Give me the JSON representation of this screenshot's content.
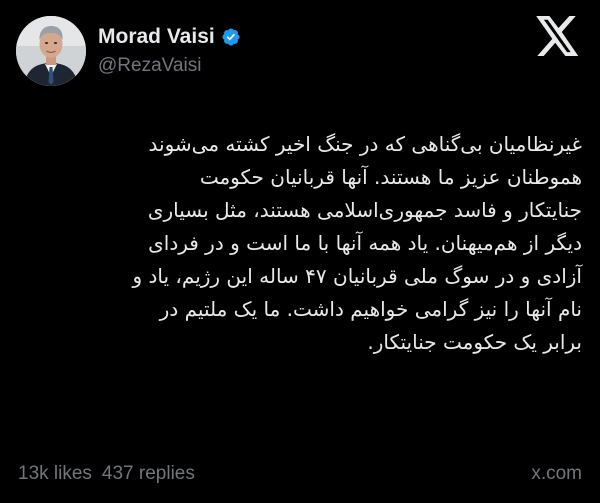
{
  "author": {
    "display_name": "Morad Vaisi",
    "handle": "@RezaVaisi",
    "verified": true,
    "avatar": "avatar"
  },
  "platform_logo": "x-logo-icon",
  "tweet": {
    "text": "غیرنظامیان بی‌گناهی که در جنگ اخیر کشته می‌شوند\nهموطنان عزیز ما هستند. آنها قربانیان حکومت\nجنایتکار و فاسد جمهوری‌اسلامی هستند، مثل بسیاری\nدیگر از هم‌میهنان. یاد همه آنها با ما است و در فردای\nآزادی و در سوگ ملی قربانیان ۴۷ ساله این رژیم، یاد و\nنام آنها را نیز گرامی خواهیم داشت. ما یک ملتیم در\nبرابر یک حکومت جنایتکار."
  },
  "stats": {
    "likes": "13k likes",
    "replies": "437 replies"
  },
  "source_domain": "x.com",
  "colors": {
    "background": "#000000",
    "text": "#e7e9ea",
    "muted": "#71767b",
    "verified_badge": "#1d9bf0"
  }
}
